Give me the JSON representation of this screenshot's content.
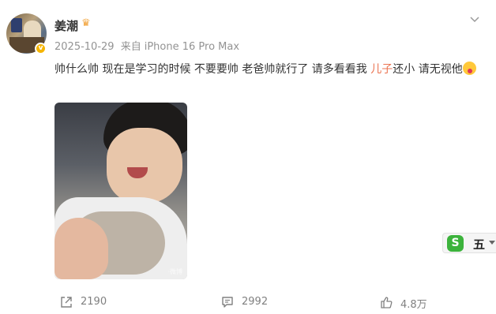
{
  "user": {
    "name": "姜潮"
  },
  "meta": {
    "date": "2025-10-29",
    "source_prefix": "来自",
    "device": "iPhone 16 Pro Max"
  },
  "post": {
    "text_part1": "帅什么帅 现在是学习的时候 不要要帅 老爸帅就行了 请多看看我 ",
    "text_highlight": "儿子",
    "text_part2": "还小 请无视他"
  },
  "photo": {
    "watermark": "·微博"
  },
  "ime": {
    "mode_label": "五"
  },
  "actions": {
    "forward_count": "2190",
    "comment_count": "2992",
    "like_count": "4.8万"
  },
  "colors": {
    "highlight": "#eb7350",
    "meta_gray": "#939393",
    "verified": "#f5b400"
  },
  "icons": {
    "avatar": "avatar",
    "verified": "verified-badge-icon",
    "crown": "crown-icon",
    "menu": "chevron-down-icon",
    "emoji": "blushing-face-icon",
    "forward": "share-icon",
    "comment": "comment-icon",
    "like": "thumbs-up-icon",
    "ime": "sogou-icon"
  }
}
